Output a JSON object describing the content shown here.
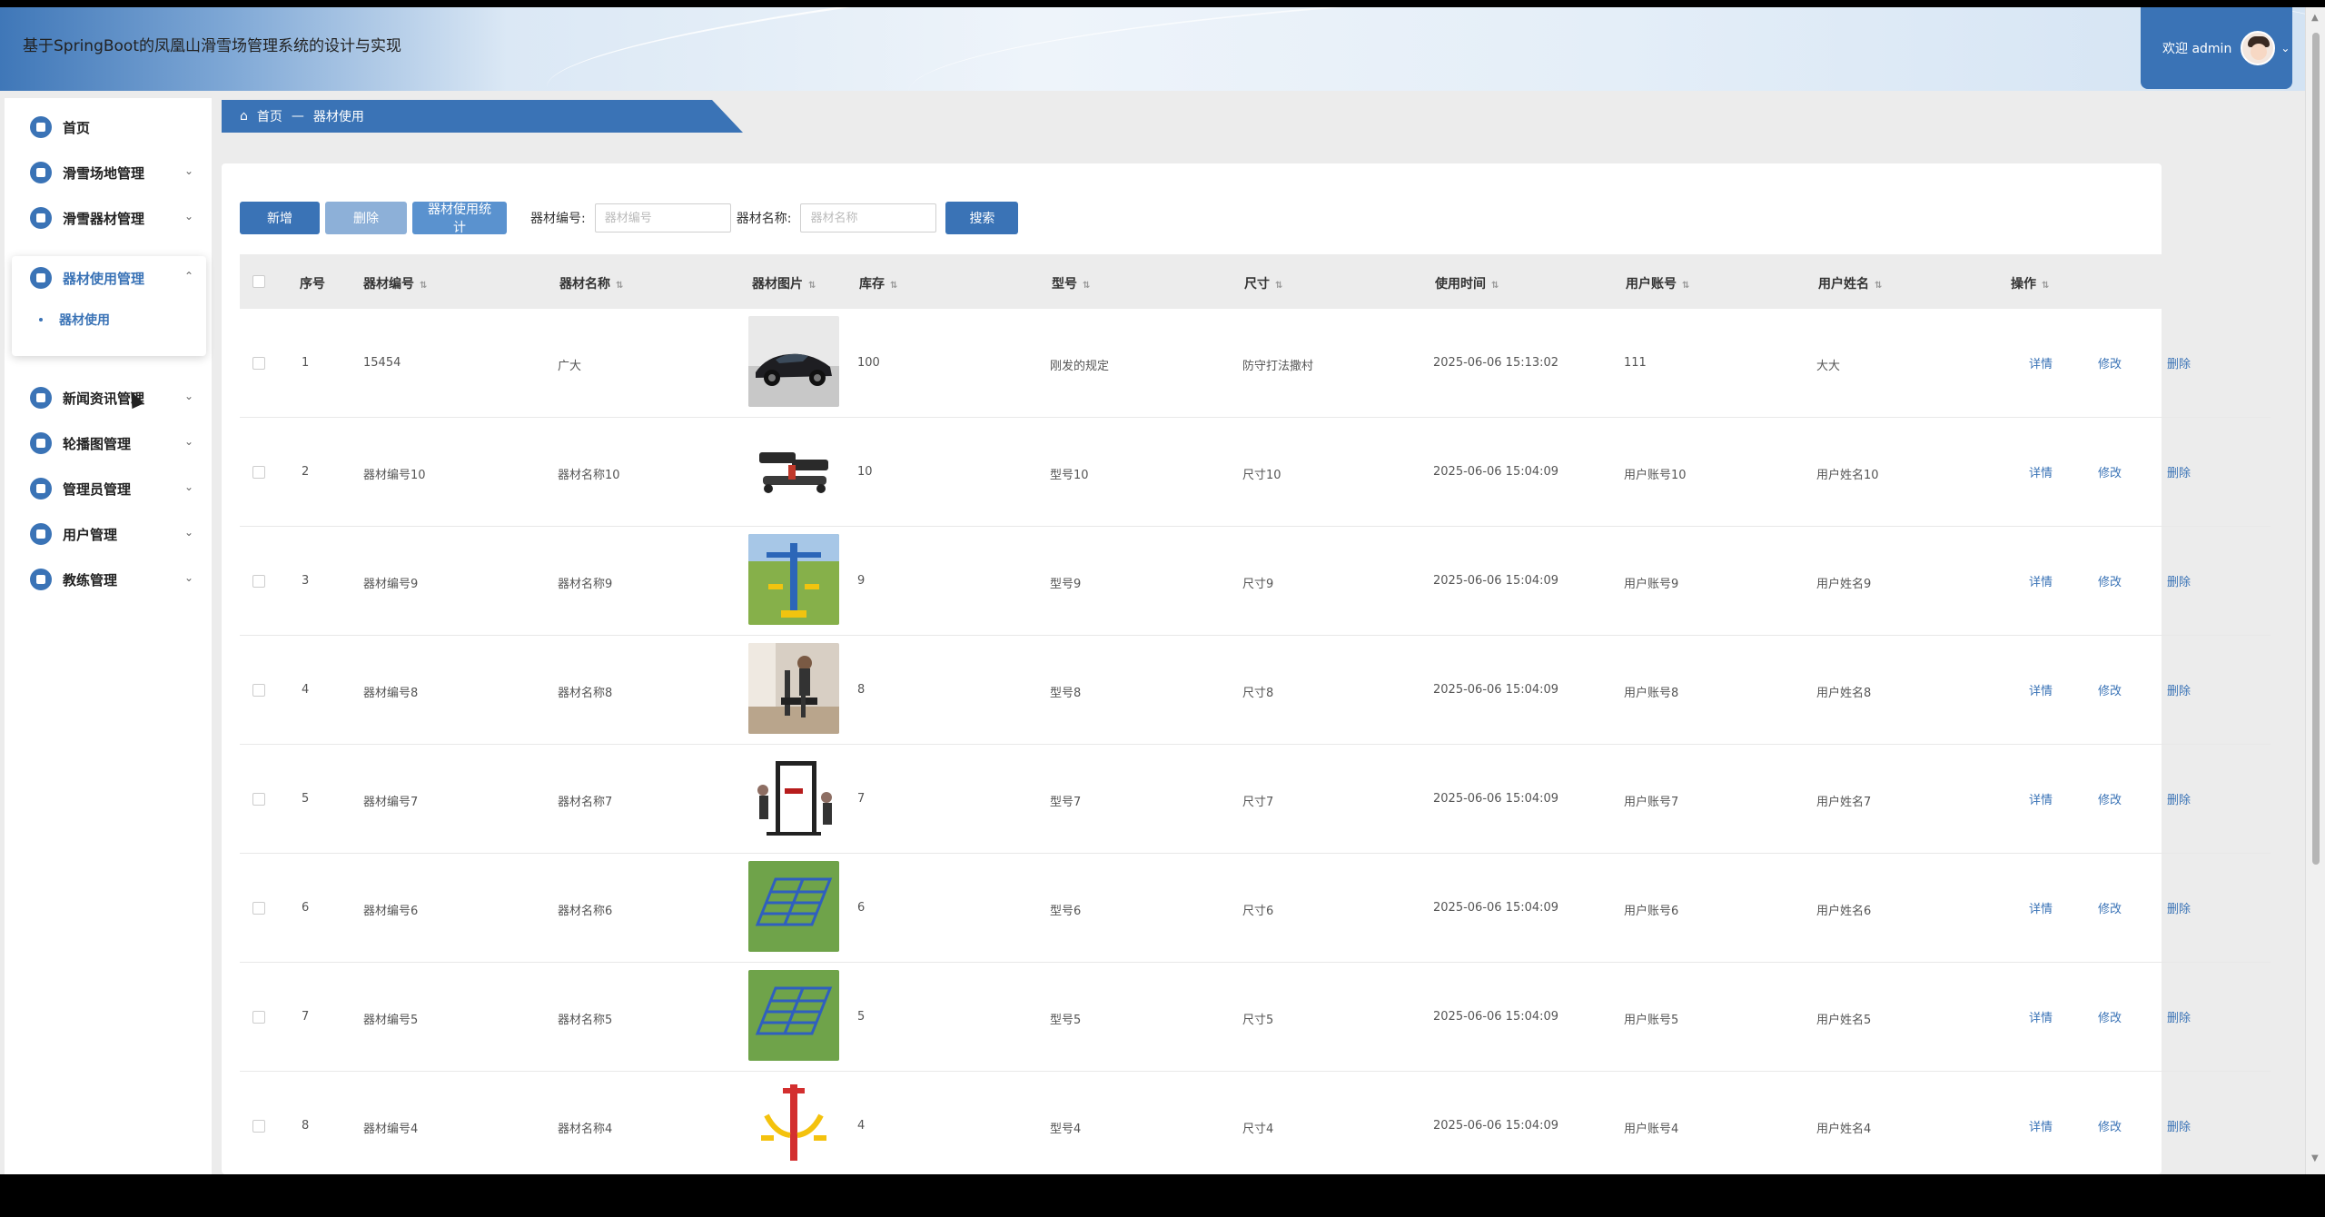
{
  "header": {
    "title": "基于SpringBoot的凤凰山滑雪场管理系统的设计与实现",
    "welcome": "欢迎 admin"
  },
  "sidebar": {
    "items": [
      {
        "label": "首页",
        "icon": "home-icon"
      },
      {
        "label": "滑雪场地管理",
        "icon": "venue-icon"
      },
      {
        "label": "滑雪器材管理",
        "icon": "equipment-icon"
      },
      {
        "label": "器材使用管理",
        "icon": "usage-icon"
      },
      {
        "label": "新闻资讯管理",
        "icon": "news-icon"
      },
      {
        "label": "轮播图管理",
        "icon": "carousel-icon"
      },
      {
        "label": "管理员管理",
        "icon": "admin-icon"
      },
      {
        "label": "用户管理",
        "icon": "user-icon"
      },
      {
        "label": "教练管理",
        "icon": "coach-icon"
      }
    ],
    "submenu_label": "器材使用"
  },
  "breadcrumb": {
    "home": "首页",
    "separator": "—",
    "current": "器材使用"
  },
  "toolbar": {
    "add_label": "新增",
    "delete_label": "删除",
    "stats_label": "器材使用统计",
    "code_label": "器材编号:",
    "code_placeholder": "器材编号",
    "name_label": "器材名称:",
    "name_placeholder": "器材名称",
    "search_label": "搜索"
  },
  "table": {
    "columns": [
      "序号",
      "器材编号",
      "器材名称",
      "器材图片",
      "库存",
      "型号",
      "尺寸",
      "使用时间",
      "用户账号",
      "用户姓名",
      "操作"
    ],
    "actions": {
      "detail": "详情",
      "edit": "修改",
      "delete": "删除"
    },
    "rows": [
      {
        "no": "1",
        "code": "15454",
        "name": "广大",
        "stock": "100",
        "model": "刚发的规定",
        "size": "防守打法撒村",
        "time": "2025-06-06 15:13:02",
        "account": "111",
        "username": "大大",
        "image": "car"
      },
      {
        "no": "2",
        "code": "器材编号10",
        "name": "器材名称10",
        "stock": "10",
        "model": "型号10",
        "size": "尺寸10",
        "time": "2025-06-06 15:04:09",
        "account": "用户账号10",
        "username": "用户姓名10",
        "image": "stepper"
      },
      {
        "no": "3",
        "code": "器材编号9",
        "name": "器材名称9",
        "stock": "9",
        "model": "型号9",
        "size": "尺寸9",
        "time": "2025-06-06 15:04:09",
        "account": "用户账号9",
        "username": "用户姓名9",
        "image": "outdoor-machine"
      },
      {
        "no": "4",
        "code": "器材编号8",
        "name": "器材名称8",
        "stock": "8",
        "model": "型号8",
        "size": "尺寸8",
        "time": "2025-06-06 15:04:09",
        "account": "用户账号8",
        "username": "用户姓名8",
        "image": "elliptical"
      },
      {
        "no": "5",
        "code": "器材编号7",
        "name": "器材名称7",
        "stock": "7",
        "model": "型号7",
        "size": "尺寸7",
        "time": "2025-06-06 15:04:09",
        "account": "用户账号7",
        "username": "用户姓名7",
        "image": "home-gym"
      },
      {
        "no": "6",
        "code": "器材编号6",
        "name": "器材名称6",
        "stock": "6",
        "model": "型号6",
        "size": "尺寸6",
        "time": "2025-06-06 15:04:09",
        "account": "用户账号6",
        "username": "用户姓名6",
        "image": "bench"
      },
      {
        "no": "7",
        "code": "器材编号5",
        "name": "器材名称5",
        "stock": "5",
        "model": "型号5",
        "size": "尺寸5",
        "time": "2025-06-06 15:04:09",
        "account": "用户账号5",
        "username": "用户姓名5",
        "image": "bench"
      },
      {
        "no": "8",
        "code": "器材编号4",
        "name": "器材名称4",
        "stock": "4",
        "model": "型号4",
        "size": "尺寸4",
        "time": "2025-06-06 15:04:09",
        "account": "用户账号4",
        "username": "用户姓名4",
        "image": "red-machine"
      }
    ]
  },
  "colors": {
    "primary": "#3a73b6",
    "disabled": "#8db0d8"
  }
}
